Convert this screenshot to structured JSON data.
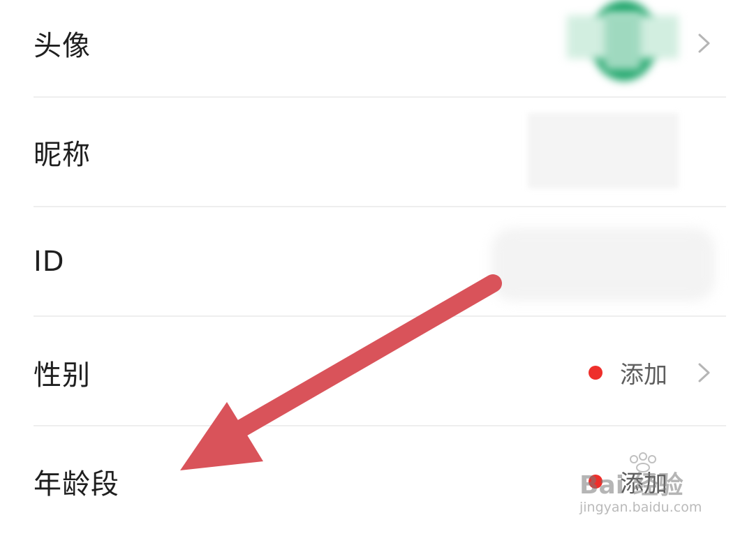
{
  "rows": [
    {
      "label": "头像"
    },
    {
      "label": "昵称"
    },
    {
      "label": "ID"
    },
    {
      "label": "性别",
      "action": "添加"
    },
    {
      "label": "年龄段",
      "action": "添加"
    }
  ],
  "watermark": {
    "brand": "Bai 经验",
    "url": "jingyan.baidu.com"
  },
  "colors": {
    "dot": "#ee2f2b",
    "arrow": "#d9535a",
    "avatar_green": "#1aaa6a"
  }
}
